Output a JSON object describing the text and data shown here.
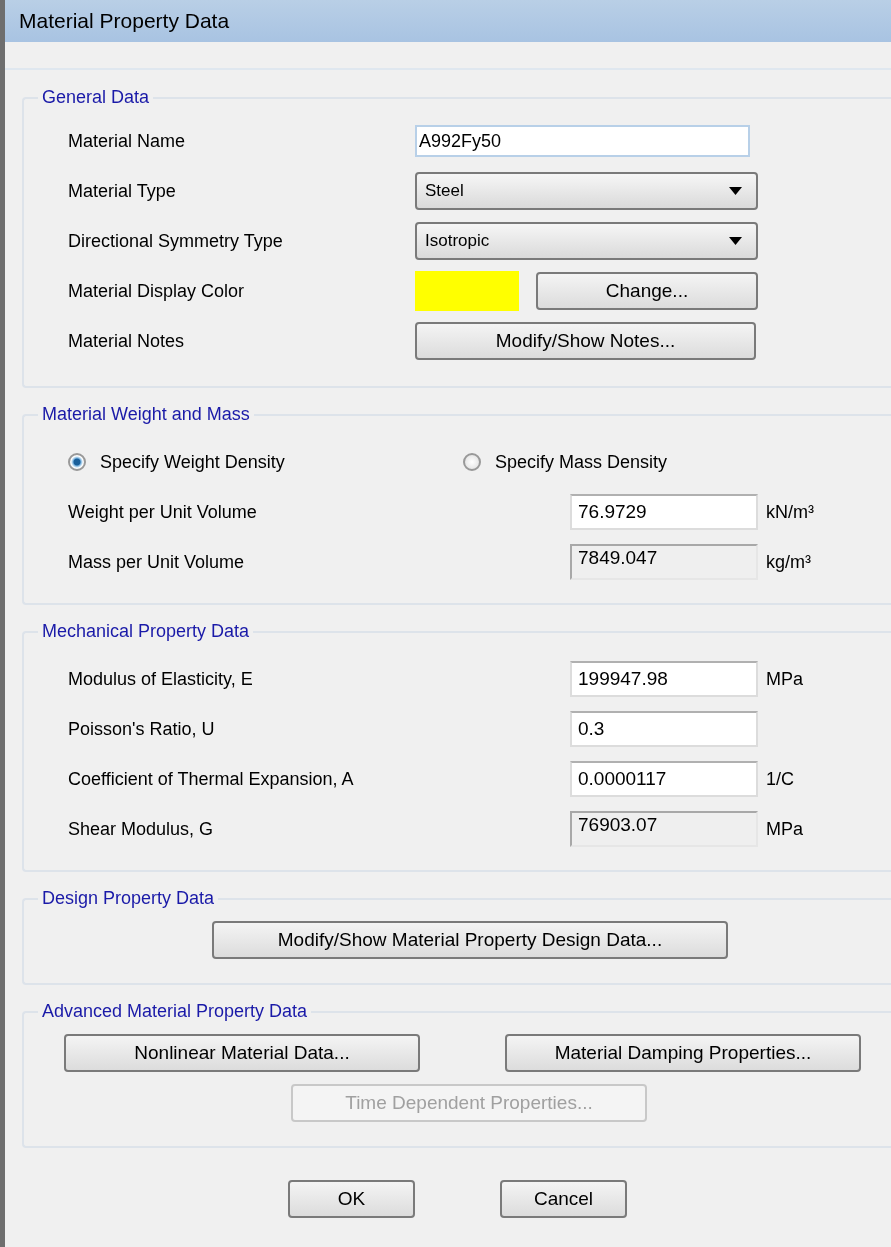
{
  "window": {
    "title": "Material Property Data"
  },
  "general": {
    "title": "General Data",
    "rows": [
      {
        "kind": "text",
        "label": "Material Name",
        "value": "A992Fy50"
      },
      {
        "kind": "dropdown",
        "label": "Material Type",
        "value": "Steel"
      },
      {
        "kind": "dropdown",
        "label": "Directional Symmetry Type",
        "value": "Isotropic"
      },
      {
        "kind": "color",
        "label": "Material Display Color",
        "color": "#ffff00",
        "button": "Change..."
      },
      {
        "kind": "button",
        "label": "Material Notes",
        "button": "Modify/Show Notes..."
      }
    ]
  },
  "weight": {
    "title": "Material Weight and Mass",
    "options": [
      {
        "label": "Specify Weight Density",
        "selected": true
      },
      {
        "label": "Specify Mass Density",
        "selected": false
      }
    ],
    "rows": [
      {
        "label": "Weight per Unit Volume",
        "value": "76.9729",
        "unit": "kN/m³",
        "disabled": false
      },
      {
        "label": "Mass per Unit Volume",
        "value": "7849.047",
        "unit": "kg/m³",
        "disabled": true
      }
    ]
  },
  "mechanical": {
    "title": "Mechanical Property Data",
    "rows": [
      {
        "label": "Modulus of Elasticity,  E",
        "value": "199947.98",
        "unit": "MPa",
        "disabled": false
      },
      {
        "label": "Poisson's Ratio,  U",
        "value": "0.3",
        "disabled": false
      },
      {
        "label": "Coefficient of Thermal Expansion,  A",
        "value": "0.0000117",
        "unit": "1/C",
        "disabled": false
      },
      {
        "label": "Shear Modulus,  G",
        "value": "76903.07",
        "unit": "MPa",
        "disabled": true
      }
    ]
  },
  "design": {
    "title": "Design Property Data",
    "button": "Modify/Show Material Property Design Data..."
  },
  "advanced": {
    "title": "Advanced Material Property Data",
    "buttons": [
      {
        "label": "Nonlinear Material Data...",
        "disabled": false
      },
      {
        "label": "Material Damping Properties...",
        "disabled": false
      },
      {
        "label": "Time Dependent Properties...",
        "disabled": true
      }
    ]
  },
  "buttons": [
    "OK",
    "Cancel"
  ]
}
